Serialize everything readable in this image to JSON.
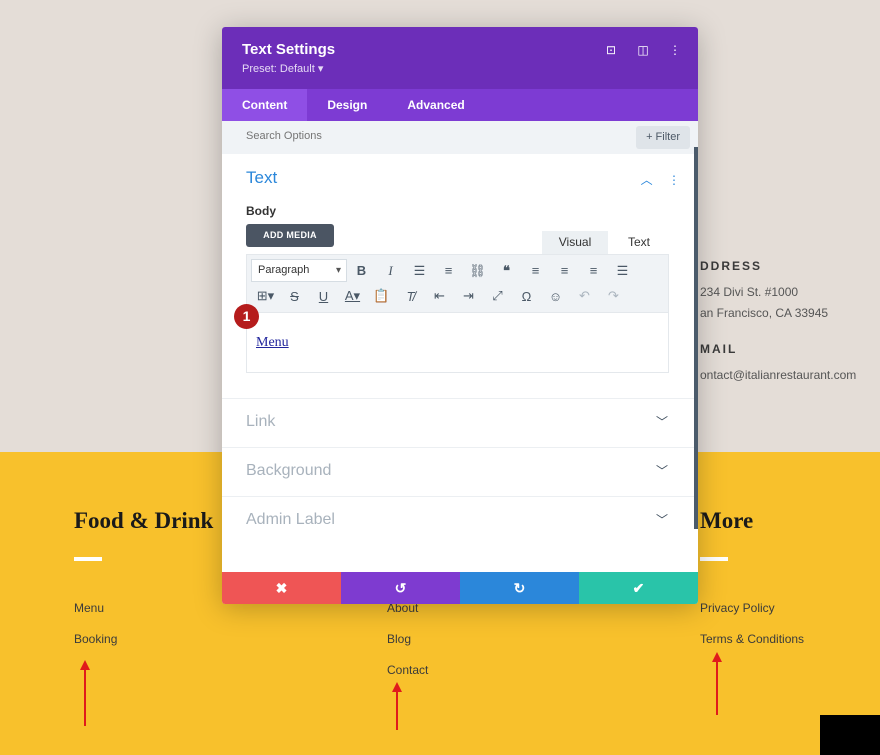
{
  "page": {
    "contact": {
      "address_heading": "DDRESS",
      "address_line1": "234 Divi St. #1000",
      "address_line2": "an Francisco, CA 33945",
      "email_heading": "MAIL",
      "email_value": "ontact@italianrestaurant.com"
    },
    "footer": {
      "col1_title": "Food & Drink",
      "col1_links": [
        "Menu",
        "Booking"
      ],
      "col2_links": [
        "About",
        "Blog",
        "Contact"
      ],
      "col3_title": "More",
      "col3_links": [
        "Privacy Policy",
        "Terms & Conditions"
      ]
    },
    "annotation_color": "#e01b1b"
  },
  "modal": {
    "title": "Text Settings",
    "preset": "Preset: Default ▾",
    "header_icons": [
      "screenshot-icon",
      "split-view-icon",
      "more-options-icon"
    ],
    "tabs": [
      "Content",
      "Design",
      "Advanced"
    ],
    "active_tab": "Content",
    "search_placeholder": "Search Options",
    "filter_label": "+ Filter",
    "text_section": {
      "title": "Text",
      "body_label": "Body",
      "add_media": "ADD MEDIA",
      "editor_tabs": [
        "Visual",
        "Text"
      ],
      "paragraph_select": "Paragraph",
      "badge": "1",
      "content_link": "Menu"
    },
    "accordions": [
      "Link",
      "Background",
      "Admin Label"
    ],
    "footer_colors": {
      "cancel": "#ef5555",
      "undo": "#7e3bd0",
      "redo": "#2b87da",
      "save": "#29c4a9"
    }
  }
}
